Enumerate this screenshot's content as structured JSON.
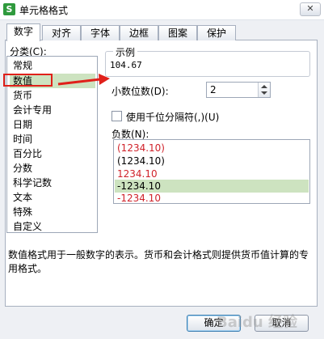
{
  "window": {
    "title": "单元格格式",
    "app_icon_letter": "S",
    "close_symbol": "✕"
  },
  "tabs": [
    {
      "label": "数字"
    },
    {
      "label": "对齐"
    },
    {
      "label": "字体"
    },
    {
      "label": "边框"
    },
    {
      "label": "图案"
    },
    {
      "label": "保护"
    }
  ],
  "category": {
    "label": "分类(C):",
    "items": [
      "常规",
      "数值",
      "货币",
      "会计专用",
      "日期",
      "时间",
      "百分比",
      "分数",
      "科学记数",
      "文本",
      "特殊",
      "自定义"
    ],
    "selected": "数值"
  },
  "sample": {
    "label": "示例",
    "value": "104.67"
  },
  "decimal": {
    "label": "小数位数(D):",
    "value": "2"
  },
  "thousands": {
    "label": "使用千位分隔符(,)(U)",
    "checked": false
  },
  "negative": {
    "label": "负数(N):",
    "items": [
      "(1234.10)",
      "(1234.10)",
      "1234.10",
      "-1234.10",
      "-1234.10"
    ],
    "selected_index": 3
  },
  "description": "数值格式用于一般数字的表示。货币和会计格式则提供货币值计算的专用格式。",
  "buttons": {
    "ok": "确定",
    "cancel": "取消"
  },
  "watermark": "Baidu 经验",
  "colors": {
    "selection": "#cde3c0",
    "negative_red": "#d0222a",
    "annotation_red": "#e0201a"
  }
}
